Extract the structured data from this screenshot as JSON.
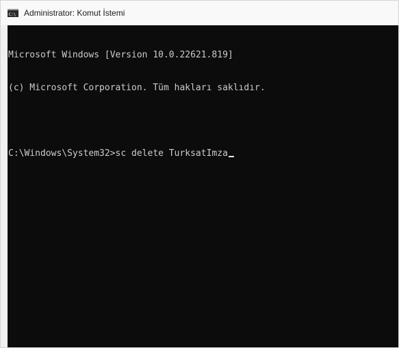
{
  "window": {
    "title": "Administrator: Komut İstemi",
    "icon": "cmd-icon"
  },
  "console": {
    "lines": [
      "Microsoft Windows [Version 10.0.22621.819]",
      "(c) Microsoft Corporation. Tüm hakları saklıdır.",
      "",
      "C:\\Windows\\System32>sc delete TurksatImza"
    ]
  },
  "colors": {
    "console_background": "#0c0c0c",
    "console_text": "#cccccc",
    "titlebar_background": "#f9f9f9"
  }
}
